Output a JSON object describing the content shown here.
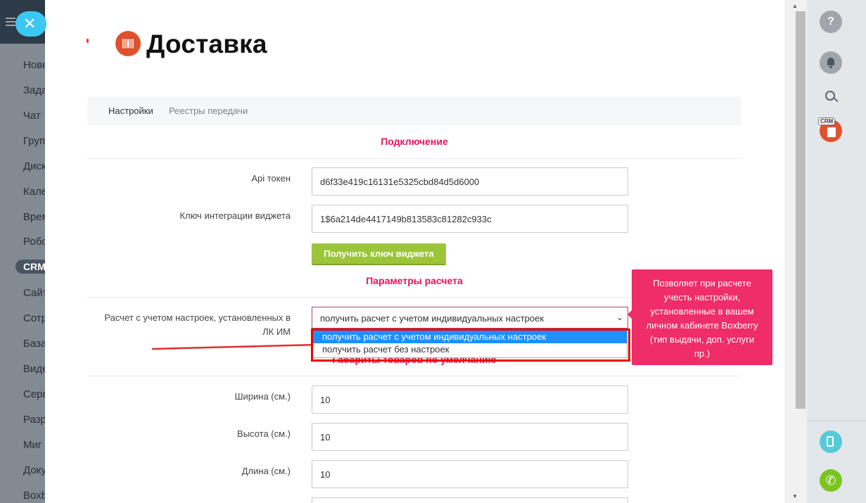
{
  "sidebar": {
    "items": [
      "Нове",
      "Зада",
      "Чат",
      "Груп",
      "Диск",
      "Кале",
      "Врем",
      "Робо",
      "CRM",
      "Сайт",
      "Сотр",
      "База",
      "Виде",
      "Серв",
      "Разр",
      "Миг",
      "Доку",
      "Boxb"
    ]
  },
  "header": {
    "title": "Доставка"
  },
  "tabs": [
    "Настройки",
    "Реестры передачи"
  ],
  "sections": {
    "connection": "Подключение",
    "calc_params": "Параметры расчета",
    "dimensions": "Габариты товаров по умолчанию"
  },
  "fields": {
    "api_token": {
      "label": "Api токен",
      "value": "d6f33e419c16131e5325cbd84d5d6000"
    },
    "widget_key": {
      "label": "Ключ интеграции виджета",
      "value": "1$6a214de4417149b813583c81282c933c"
    },
    "get_widget_key_button": "Получить ключ виджета",
    "calc_mode": {
      "label_line1": "Расчет с учетом настроек, установленных в",
      "label_line2": "ЛК ИМ",
      "value": "получить расчет с учетом индивидуальных настроек",
      "options": [
        "получить расчет с учетом индивидуальных настроек",
        "получить расчет без настроек"
      ]
    },
    "width": {
      "label": "Ширина (см.)",
      "value": "10"
    },
    "height": {
      "label": "Высота (см.)",
      "value": "10"
    },
    "length": {
      "label": "Длина (см.)",
      "value": "10"
    }
  },
  "tooltip": {
    "lines": [
      "Позволяет при расчете",
      "учесть настройки,",
      "установленные в вашем",
      "личном кабинете Boxberry",
      "(тип выдачи, доп. услуги",
      "пр.)"
    ]
  },
  "rightbar": {
    "help_glyph": "?",
    "crm_tag": "CRM"
  },
  "colors": {
    "accent": "#e8135f",
    "button_green": "#9cc53a",
    "tooltip_bg": "#ef2d68",
    "close_button": "#3bc8f5"
  }
}
